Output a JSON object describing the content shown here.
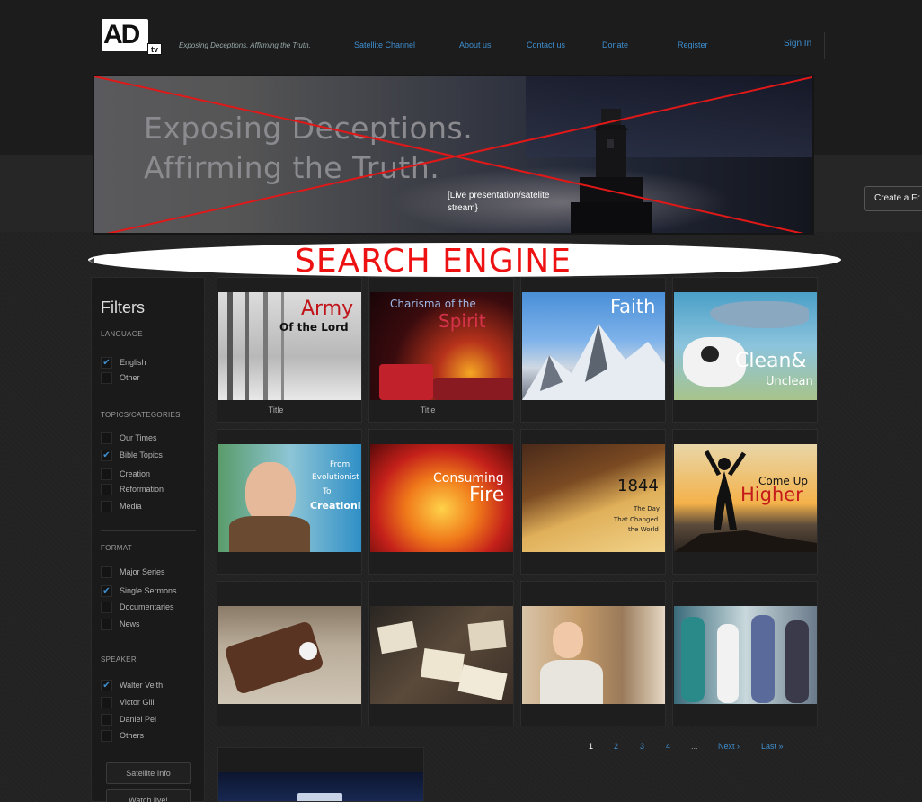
{
  "logo": {
    "text": "AD",
    "badge": "tv"
  },
  "tagline": "Exposing Deceptions. Affirming the Truth.",
  "nav": {
    "items": [
      "Satellite Channel",
      "About us",
      "Contact us",
      "Donate",
      "Register"
    ],
    "signin": "Sign In"
  },
  "hero": {
    "line1": "Exposing Deceptions.",
    "line2": "Affirming the Truth.",
    "caption": "[Live presentation/satelite stream}"
  },
  "create_tab": "Create a Fr",
  "search": {
    "label": "SEARCH ENGINE"
  },
  "sidebar": {
    "title": "Filters",
    "language": {
      "label": "LANGUAGE",
      "options": [
        {
          "label": "English",
          "checked": "✔"
        },
        {
          "label": "Other",
          "checked": ""
        }
      ]
    },
    "topics": {
      "label": "TOPICS/CATEGORIES",
      "options": [
        {
          "label": "Our Times",
          "checked": ""
        },
        {
          "label": "Bible Topics",
          "checked": "✔"
        },
        {
          "label": "Creation",
          "checked": ""
        },
        {
          "label": "Reformation",
          "checked": ""
        },
        {
          "label": "Media",
          "checked": ""
        }
      ]
    },
    "format": {
      "label": "FORMAT",
      "options": [
        {
          "label": "Major Series",
          "checked": ""
        },
        {
          "label": "Single Sermons",
          "checked": "✔"
        },
        {
          "label": "Documentaries",
          "checked": ""
        },
        {
          "label": "News",
          "checked": ""
        }
      ]
    },
    "speaker": {
      "label": "SPEAKER",
      "options": [
        {
          "label": "Walter Veith",
          "checked": "✔"
        },
        {
          "label": "Victor Gill",
          "checked": ""
        },
        {
          "label": "Daniel Pel",
          "checked": ""
        },
        {
          "label": "Others",
          "checked": ""
        }
      ]
    },
    "buttons": [
      "Satellite Info",
      "Watch live!"
    ]
  },
  "grid": {
    "cards": [
      {
        "caption": "Title",
        "l1": "Army",
        "l2": "Of the Lord"
      },
      {
        "caption": "Title",
        "l1": "Charisma of the",
        "l2": "Spirit"
      },
      {
        "caption": "",
        "l1": "Faith",
        "l2": ""
      },
      {
        "caption": "",
        "l1": "Clean&",
        "l2": "Unclean"
      },
      {
        "caption": "",
        "l1": "From",
        "l2": "Evolutionist",
        "l3": "To",
        "l4": "Creationist"
      },
      {
        "caption": "",
        "l1": "Consuming",
        "l2": "Fire"
      },
      {
        "caption": "",
        "l1": "1844",
        "l2": "The Day",
        "l3": "That Changed",
        "l4": "the World"
      },
      {
        "caption": "",
        "l1": "Come Up",
        "l2": "Higher"
      },
      {
        "caption": "",
        "l1": "",
        "l2": ""
      },
      {
        "caption": "",
        "l1": "",
        "l2": ""
      },
      {
        "caption": "",
        "l1": "",
        "l2": ""
      },
      {
        "caption": "",
        "l1": "",
        "l2": ""
      }
    ]
  },
  "pager": {
    "pages": [
      "1",
      "2",
      "3",
      "4",
      "..."
    ],
    "next": "Next ›",
    "last": "Last »"
  }
}
